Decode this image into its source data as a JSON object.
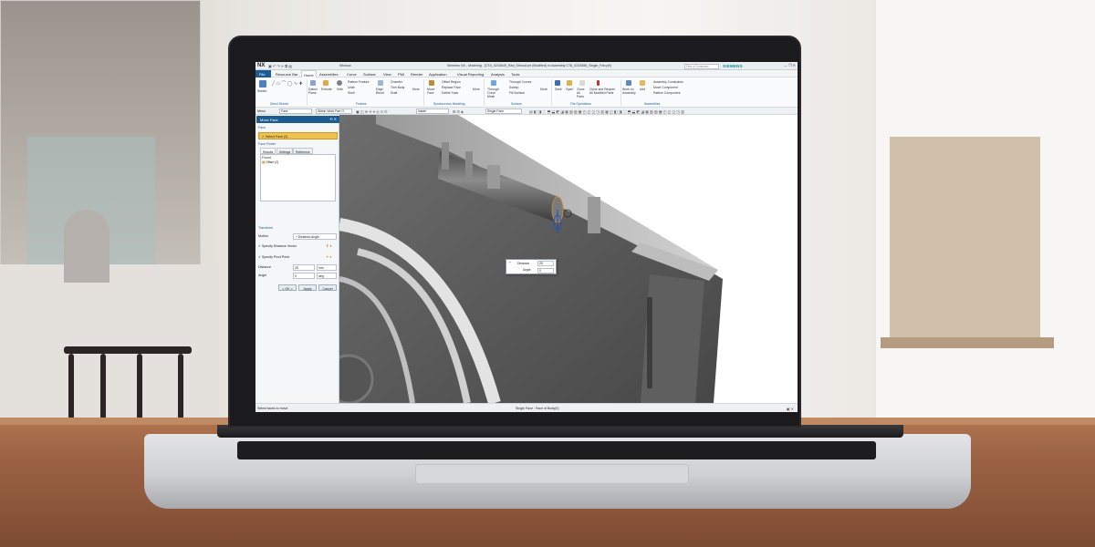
{
  "app": {
    "logo": "NX",
    "window_title": "Siemens NX - Modeling - [CTA_0234649_Rad_Shroud.prt (Modified) in Assembly CTA_0234656_Single_Fan.prt]",
    "window_menu": "Window",
    "brand": "SIEMENS",
    "window_controls": "— ❐ ✕",
    "search_placeholder": "Find a Command"
  },
  "menubar": {
    "items": [
      "File",
      "Resource Bar",
      "Home",
      "Assemblies",
      "Curve",
      "Surface",
      "View",
      "PMI",
      "Render",
      "Application",
      "Visual Reporting",
      "Analysis",
      "Tools"
    ],
    "active": "Home"
  },
  "ribbon": {
    "sketch": "Sketch",
    "direct_sketch_group": "Direct Sketch",
    "datum_plane": "Datum Plane",
    "extrude": "Extrude",
    "hole": "Hole",
    "pattern_feature": "Pattern Feature",
    "unite": "Unite",
    "shell": "Shell",
    "edge_blend": "Edge Blend",
    "chamfer": "Chamfer",
    "trim_body": "Trim Body",
    "draft": "Draft",
    "more_feature": "More",
    "feature_group": "Feature",
    "move_face": "Move Face",
    "offset_region": "Offset Region",
    "replace_face": "Replace Face",
    "delete_face": "Delete Face",
    "more_sync": "More",
    "sync_group": "Synchronous Modeling",
    "through_curve_mesh": "Through Curve Mesh",
    "through_curves": "Through Curves",
    "sweep": "Sweep",
    "fill_surface": "Fill Surface",
    "more_surface": "More",
    "surface_group": "Surface",
    "save": "Save",
    "open": "Open",
    "close_all_parts": "Close All Parts",
    "close_and_reopen": "Close and Reopen All Modified Parts",
    "file_ops_group": "File Operations",
    "work_on_assembly": "Work on Assembly",
    "add": "Add",
    "assembly_constraints": "Assembly Constraints",
    "move_component": "Move Component",
    "pattern_component": "Pattern Component",
    "assemblies_group": "Assemblies"
  },
  "selbar": {
    "menu": "Menu",
    "filter": "Face",
    "scope": "Within Work Part O",
    "inside": "Inside",
    "single_face": "Single Face"
  },
  "dialog": {
    "title": "Move Face",
    "face_section": "Face",
    "select_face": "Select Face (2)",
    "face_finder_section": "Face Finder",
    "tabs": [
      "Results",
      "Settings",
      "Reference"
    ],
    "found_label": "Found",
    "found_item": "Offset (2)",
    "transform_section": "Transform",
    "motion_label": "Motion",
    "motion_value": "Distance-Angle",
    "distance_vector": "Specify Distance Vector",
    "pivot_point": "Specify Pivot Point",
    "distance_label": "Distance",
    "distance_value": "25",
    "distance_unit": "mm",
    "angle_label": "Angle",
    "angle_value": "0",
    "angle_unit": "deg",
    "ok": "< OK >",
    "apply": "Apply",
    "cancel": "Cancel"
  },
  "popup": {
    "distance_label": "Distance",
    "distance_value": "25",
    "angle_label": "Angle",
    "angle_value": "0"
  },
  "status": {
    "left": "Select faces to move",
    "center": "Single Face : Face of Body(0)"
  },
  "colors": {
    "accent": "#1c5c93",
    "highlight": "#f0c350",
    "brand": "#0a8c95"
  }
}
